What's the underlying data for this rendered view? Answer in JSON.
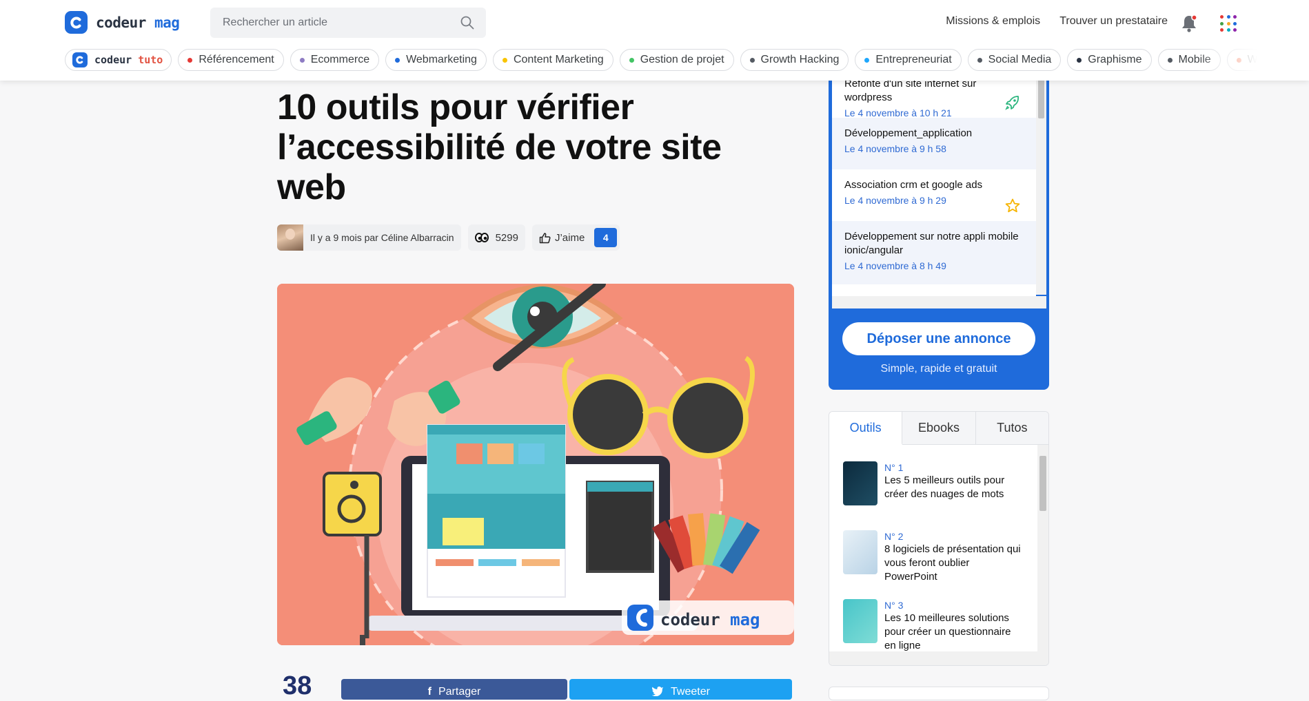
{
  "header": {
    "logo": {
      "word1": "codeur",
      "word2": "mag"
    },
    "search_placeholder": "Rechercher un article",
    "links": [
      "Missions & emplois",
      "Trouver un prestataire"
    ],
    "icons": [
      "search-icon",
      "bell-icon",
      "apps-grid-icon"
    ],
    "notification_dot_color": "#e53935",
    "apps_grid_colors": [
      "#e53935",
      "#1f6bdb",
      "#8e24aa",
      "#43a047",
      "#f9a825",
      "#1f6bdb",
      "#e53935",
      "#00acc1",
      "#8e24aa"
    ]
  },
  "categories": {
    "tuto": {
      "word1": "codeur",
      "word2": "tuto"
    },
    "items": [
      {
        "label": "Référencement",
        "color": "#e53935"
      },
      {
        "label": "Ecommerce",
        "color": "#8e7cc3"
      },
      {
        "label": "Webmarketing",
        "color": "#1f6bdb"
      },
      {
        "label": "Content Marketing",
        "color": "#f9c400"
      },
      {
        "label": "Gestion de projet",
        "color": "#43c465"
      },
      {
        "label": "Growth Hacking",
        "color": "#555b63"
      },
      {
        "label": "Entrepreneuriat",
        "color": "#1ea7fd"
      },
      {
        "label": "Social Media",
        "color": "#555b63"
      },
      {
        "label": "Graphisme",
        "color": "#2a3342"
      },
      {
        "label": "Mobile",
        "color": "#555b63"
      },
      {
        "label": "Webdesi",
        "color": "#f4704c"
      }
    ]
  },
  "article": {
    "title": "10 outils pour vérifier l’accessibilité de votre site web",
    "meta": {
      "ago": "Il y a 9 mois par",
      "author": "Céline Albarracin"
    },
    "views": "5299",
    "like_label": "J’aime",
    "like_count": "4",
    "hero_watermark": {
      "word1": "codeur",
      "word2": "mag"
    },
    "share_count": "38",
    "share_buttons": {
      "facebook": "Partager",
      "twitter": "Tweeter"
    }
  },
  "annonces": {
    "items": [
      {
        "title": "Refonte d'un site internet sur wordpress",
        "date": "Le 4 novembre à 10 h 21",
        "icon": "rocket-icon"
      },
      {
        "title": "Développement_application",
        "date": "Le 4 novembre à 9 h 58",
        "icon": ""
      },
      {
        "title": "Association crm et google ads",
        "date": "Le 4 novembre à 9 h 29",
        "icon": "star-icon"
      },
      {
        "title": "Développement sur notre appli mobile ionic/angular",
        "date": "Le 4 novembre à 8 h 49",
        "icon": ""
      }
    ],
    "cta": "Déposer une annonce",
    "cta_sub": "Simple, rapide et gratuit"
  },
  "tabs": {
    "labels": [
      "Outils",
      "Ebooks",
      "Tutos"
    ],
    "active": "Outils",
    "tools": [
      {
        "rank": "N° 1",
        "title": "Les 5 meilleurs outils pour créer des nuages de mots"
      },
      {
        "rank": "N° 2",
        "title": "8 logiciels de présentation qui vous feront oublier PowerPoint"
      },
      {
        "rank": "N° 3",
        "title": "Les 10 meilleures solutions pour créer un questionnaire en ligne"
      }
    ]
  }
}
